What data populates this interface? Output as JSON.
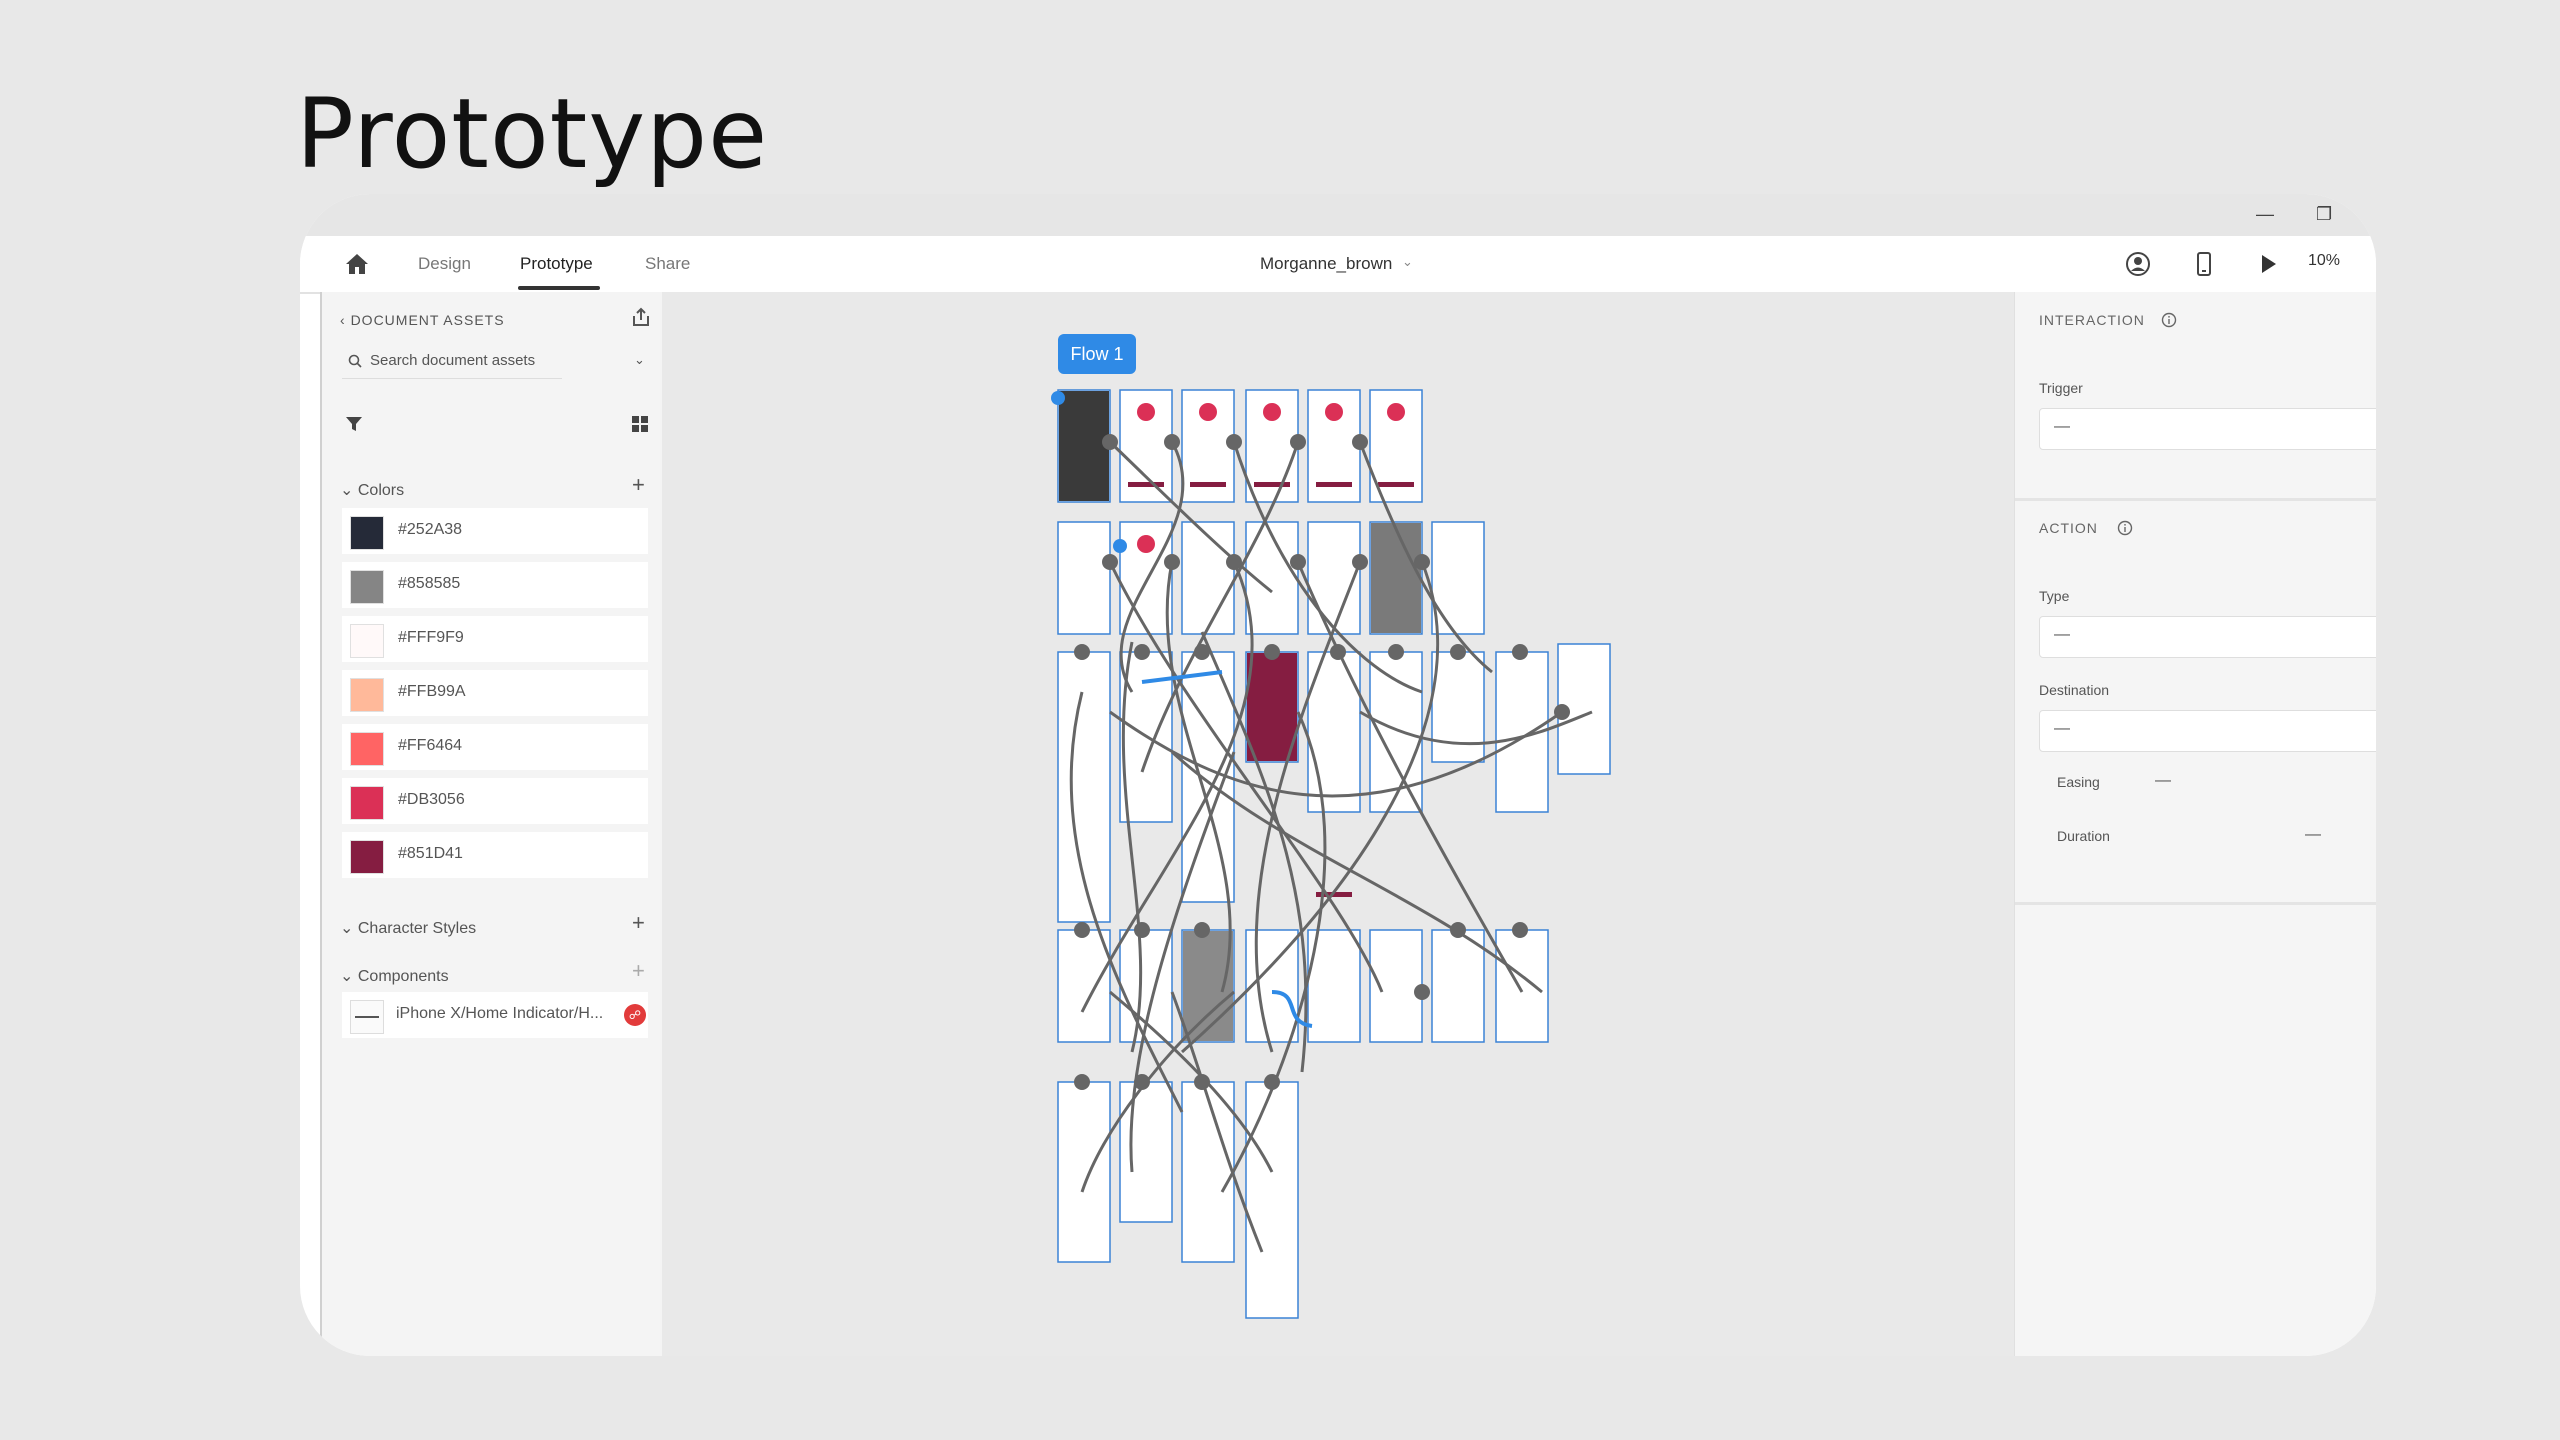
{
  "slide": {
    "title": "Prototype"
  },
  "toolbar": {
    "tabs": [
      "Design",
      "Prototype",
      "Share"
    ],
    "active_tab": "Prototype",
    "document_name": "Morganne_brown",
    "zoom": "10%"
  },
  "assets": {
    "header": "DOCUMENT ASSETS",
    "search_placeholder": "Search document assets",
    "colors_label": "Colors",
    "colors": [
      {
        "hex": "#252A38",
        "label": "#252A38"
      },
      {
        "hex": "#858585",
        "label": "#858585"
      },
      {
        "hex": "#FFF9F9",
        "label": "#FFF9F9"
      },
      {
        "hex": "#FFB99A",
        "label": "#FFB99A"
      },
      {
        "hex": "#FF6464",
        "label": "#FF6464"
      },
      {
        "hex": "#DB3056",
        "label": "#DB3056"
      },
      {
        "hex": "#851D41",
        "label": "#851D41"
      }
    ],
    "character_styles_label": "Character Styles",
    "components_label": "Components",
    "components": [
      {
        "label": "iPhone X/Home Indicator/H..."
      }
    ]
  },
  "canvas": {
    "flow_label": "Flow 1"
  },
  "interaction": {
    "header": "INTERACTION",
    "trigger_label": "Trigger",
    "trigger_value": "—"
  },
  "action": {
    "header": "ACTION",
    "type_label": "Type",
    "type_value": "—",
    "destination_label": "Destination",
    "destination_value": "—",
    "easing_label": "Easing",
    "easing_value": "—",
    "duration_label": "Duration",
    "duration_value": "—"
  },
  "icons": [
    "home-icon",
    "mobile-device-icon",
    "play-icon",
    "account-icon",
    "search-icon",
    "filter-icon",
    "grid-view-icon",
    "export-icon",
    "info-icon",
    "chevron-down-icon",
    "back-chevron-icon",
    "plus-icon",
    "link-icon"
  ],
  "colors": {
    "accent": "#2f8ae6",
    "brand_dark": "#851D41"
  }
}
